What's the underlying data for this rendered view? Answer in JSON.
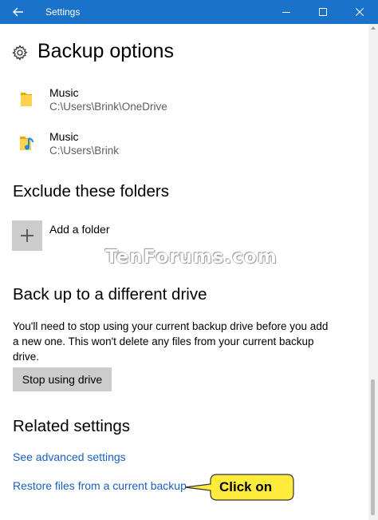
{
  "window": {
    "title": "Settings",
    "accent_color": "#1a73c8"
  },
  "page": {
    "title": "Backup options",
    "icon": "gear-icon"
  },
  "folders": [
    {
      "name": "Music",
      "path": "C:\\Users\\Brink\\OneDrive",
      "icon": "folder-icon"
    },
    {
      "name": "Music",
      "path": "C:\\Users\\Brink",
      "icon": "music-folder-icon"
    }
  ],
  "exclude": {
    "heading": "Exclude these folders",
    "add_label": "Add a folder"
  },
  "watermark": "TenForums.com",
  "different_drive": {
    "heading": "Back up to a different drive",
    "description": "You'll need to stop using your current backup drive before you add a new one. This won't delete any files from your current backup drive.",
    "button_label": "Stop using drive"
  },
  "related": {
    "heading": "Related settings",
    "links": [
      "See advanced settings",
      "Restore files from a current backup"
    ]
  },
  "callout": {
    "text": "Click on",
    "color": "#ffeb3b"
  },
  "link_color": "#1a5fbe"
}
